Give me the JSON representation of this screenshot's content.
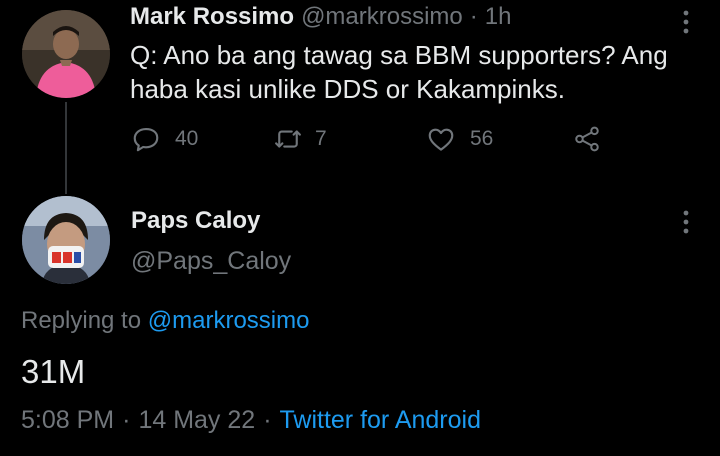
{
  "parent_tweet": {
    "display_name": "Mark Rossimo",
    "handle": "@markrossimo",
    "separator": "·",
    "time_ago": "1h",
    "text_line1": "Q: Ano ba ang tawag sa BBM supporters? Ang",
    "text_line2": "haba kasi unlike DDS or Kakampinks.",
    "reply_count": "40",
    "retweet_count": "7",
    "like_count": "56",
    "icons": [
      "reply-icon",
      "retweet-icon",
      "like-icon",
      "share-icon",
      "more-icon"
    ]
  },
  "reply_tweet": {
    "display_name": "Paps Caloy",
    "handle": "@Paps_Caloy",
    "replying_to_label": "Replying to",
    "replying_to_handle": "@markrossimo",
    "text": "31M",
    "time": "5:08 PM",
    "separator": "·",
    "date": "14 May 22",
    "source": "Twitter for Android"
  },
  "colors": {
    "background": "#000000",
    "text": "#e7e9ea",
    "muted": "#71767b",
    "link": "#1d9bf0"
  }
}
